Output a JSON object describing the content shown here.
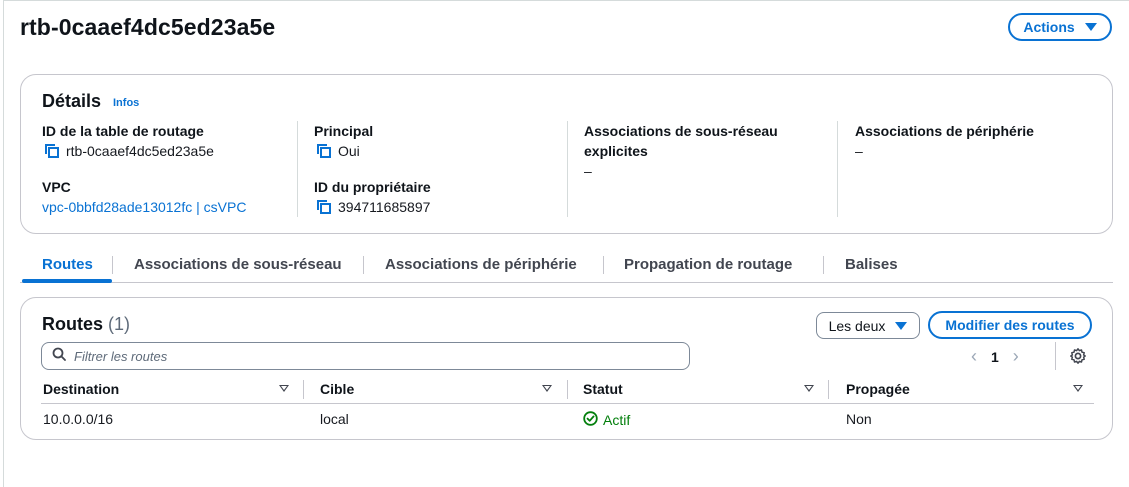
{
  "header": {
    "title": "rtb-0caaef4dc5ed23a5e",
    "actions_label": "Actions"
  },
  "details": {
    "title": "Détails",
    "info_label": "Infos",
    "route_table_id_label": "ID de la table de routage",
    "route_table_id_value": "rtb-0caaef4dc5ed23a5e",
    "vpc_label": "VPC",
    "vpc_value": "vpc-0bbfd28ade13012fc | csVPC",
    "main_label": "Principal",
    "main_value": "Oui",
    "owner_label": "ID du propriétaire",
    "owner_value": "394711685897",
    "subnet_assoc_label_line1": "Associations de sous-réseau",
    "subnet_assoc_label_line2": "explicites",
    "subnet_assoc_value": "–",
    "edge_assoc_label": "Associations de périphérie",
    "edge_assoc_value": "–"
  },
  "tabs": [
    {
      "label": "Routes",
      "active": true
    },
    {
      "label": "Associations de sous-réseau",
      "active": false
    },
    {
      "label": "Associations de périphérie",
      "active": false
    },
    {
      "label": "Propagation de routage",
      "active": false
    },
    {
      "label": "Balises",
      "active": false
    }
  ],
  "routes": {
    "title": "Routes",
    "count": "(1)",
    "filter_dropdown": "Les deux",
    "edit_button": "Modifier des routes",
    "search_placeholder": "Filtrer les routes",
    "page": "1",
    "columns": [
      "Destination",
      "Cible",
      "Statut",
      "Propagée"
    ],
    "rows": [
      {
        "destination": "10.0.0.0/16",
        "target": "local",
        "status": "Actif",
        "propagated": "Non"
      }
    ]
  },
  "colors": {
    "accent": "#0972d3",
    "success": "#037f0c",
    "text": "#0f141a",
    "border": "#c6c6cd"
  }
}
